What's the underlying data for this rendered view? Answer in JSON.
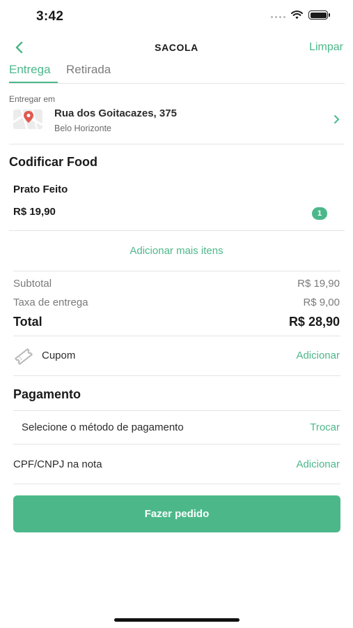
{
  "status_bar": {
    "time": "3:42"
  },
  "header": {
    "title": "SACOLA",
    "clear_label": "Limpar"
  },
  "tabs": [
    {
      "label": "Entrega",
      "active": true
    },
    {
      "label": "Retirada",
      "active": false
    }
  ],
  "address": {
    "label": "Entregar em",
    "street": "Rua dos Goitacazes, 375",
    "city": "Belo Horizonte"
  },
  "store": {
    "name": "Codificar Food"
  },
  "items": [
    {
      "name": "Prato Feito",
      "price": "R$ 19,90",
      "quantity": "1"
    }
  ],
  "add_more_label": "Adicionar mais itens",
  "summary": {
    "subtotal_label": "Subtotal",
    "subtotal_value": "R$ 19,90",
    "delivery_label": "Taxa de entrega",
    "delivery_value": "R$ 9,00",
    "total_label": "Total",
    "total_value": "R$ 28,90"
  },
  "coupon": {
    "label": "Cupom",
    "action": "Adicionar"
  },
  "payment": {
    "title": "Pagamento",
    "method_label": "Selecione o método de pagamento",
    "method_action": "Trocar"
  },
  "tax_id": {
    "label": "CPF/CNPJ na nota",
    "action": "Adicionar"
  },
  "order_button": "Fazer pedido",
  "colors": {
    "accent": "#4cb88a",
    "text": "#1a1a1a",
    "muted": "#7a7a7a",
    "divider": "#e3e3e3"
  }
}
